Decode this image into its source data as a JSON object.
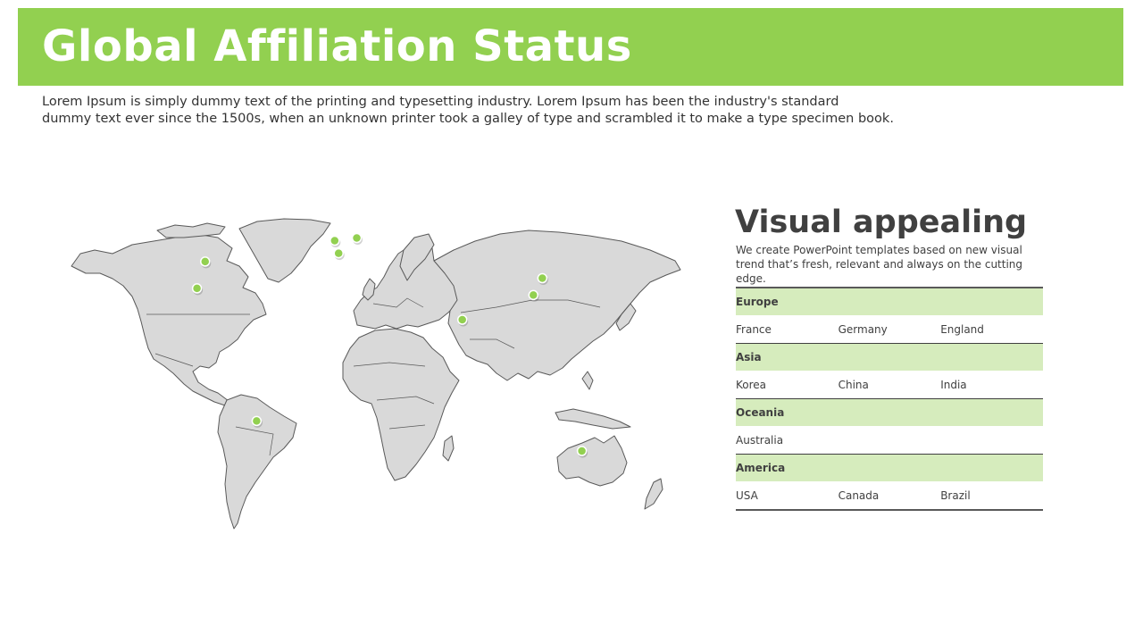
{
  "header": {
    "title": "Global Affiliation Status",
    "accent_color": "#92d050"
  },
  "intro": {
    "line1": "Lorem Ipsum is simply dummy text of the printing and typesetting industry. Lorem Ipsum has been the industry's standard",
    "line2": "dummy text ever since the 1500s, when an unknown printer took a galley of type and scrambled it to make a type specimen book."
  },
  "side_panel": {
    "title": "Visual appealing",
    "description": "We create PowerPoint templates based on new visual trend that’s fresh, relevant and always on the cutting edge.",
    "header_fill_color": "#d6ecbd"
  },
  "regions": [
    {
      "name": "Europe",
      "countries": [
        "France",
        "Germany",
        "England"
      ]
    },
    {
      "name": "Asia",
      "countries": [
        "Korea",
        "China",
        "India"
      ]
    },
    {
      "name": "Oceania",
      "countries": [
        "Australia"
      ]
    },
    {
      "name": "America",
      "countries": [
        "USA",
        "Canada",
        "Brazil"
      ]
    }
  ],
  "map": {
    "land_color": "#d9d9d9",
    "outline_color": "#595959",
    "marker_color": "#92d050",
    "markers": [
      {
        "name": "Canada",
        "lon": -79.4,
        "lat": 43.7
      },
      {
        "name": "USA",
        "lon": -84.4,
        "lat": 33.7
      },
      {
        "name": "Brazil",
        "lon": -47.9,
        "lat": -15.8
      },
      {
        "name": "England",
        "lon": -0.1,
        "lat": 51.5
      },
      {
        "name": "France",
        "lon": 2.3,
        "lat": 46.8
      },
      {
        "name": "Germany",
        "lon": 13.4,
        "lat": 52.5
      },
      {
        "name": "India",
        "lon": 78.0,
        "lat": 22.0
      },
      {
        "name": "China",
        "lon": 121.5,
        "lat": 31.2
      },
      {
        "name": "Korea",
        "lon": 127.0,
        "lat": 37.5
      },
      {
        "name": "Australia",
        "lon": 151.2,
        "lat": -27.0
      }
    ]
  }
}
